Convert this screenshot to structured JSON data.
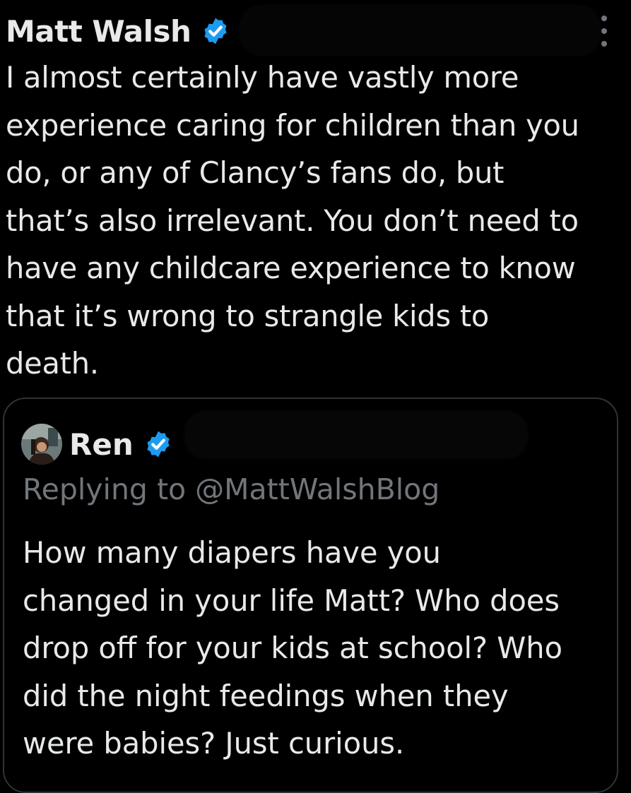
{
  "post": {
    "author_name": "Matt Walsh",
    "verified_icon": "verified-badge-icon",
    "more_icon": "more-options-icon",
    "text": "I almost certainly have vastly more\nexperience caring for children than you\ndo, or any of Clancy’s fans do, but\nthat’s also irrelevant. You don’t need to\nhave any childcare experience to know\nthat it’s wrong to strangle kids to\ndeath."
  },
  "quote": {
    "author_name": "Ren",
    "avatar_icon": "avatar",
    "verified_icon": "verified-badge-icon",
    "replying_to": "Replying to @MattWalshBlog",
    "text": "How many diapers have you\nchanged in your life Matt? Who does\ndrop off for your kids at school? Who\ndid the night feedings when they\nwere babies? Just curious."
  },
  "colors": {
    "background": "#000000",
    "text_primary": "#e7e9ea",
    "text_secondary": "#71767b",
    "verified_blue": "#1d9bf0",
    "border": "#2f3336"
  }
}
